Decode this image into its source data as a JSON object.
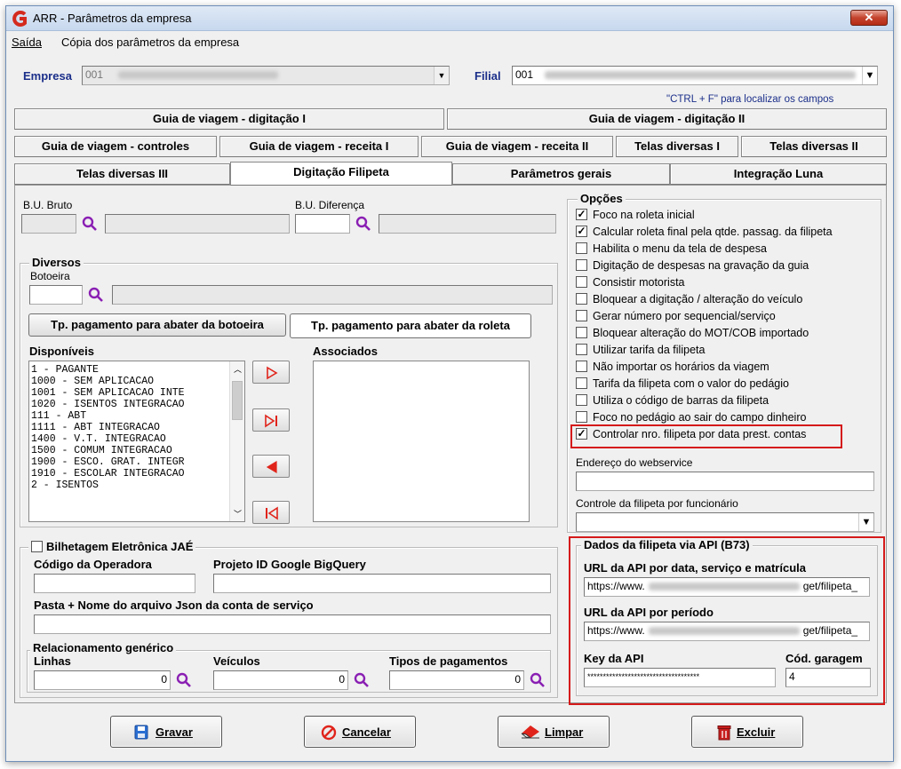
{
  "window": {
    "title": "ARR - Parâmetros da empresa",
    "close_glyph": "✕"
  },
  "menu": {
    "items": [
      "Saída",
      "Cópia dos parâmetros da empresa"
    ]
  },
  "empresa": {
    "label": "Empresa",
    "code": "001"
  },
  "filial": {
    "label": "Filial",
    "code": "001"
  },
  "hint": "\"CTRL + F\" para localizar os campos",
  "tabs": {
    "row1": [
      "Guia de viagem - digitação I",
      "Guia de viagem - digitação II"
    ],
    "row2": [
      "Guia de viagem - controles",
      "Guia de viagem - receita I",
      "Guia de viagem - receita II",
      "Telas diversas I",
      "Telas diversas II"
    ],
    "row3": [
      "Telas diversas III",
      "Digitação Filipeta",
      "Parâmetros gerais",
      "Integração Luna"
    ],
    "active": "Digitação Filipeta"
  },
  "bu": {
    "bruto_label": "B.U. Bruto",
    "diferenca_label": "B.U. Diferença"
  },
  "diversos": {
    "title": "Diversos",
    "botoeira_label": "Botoeira",
    "btn_botoeira": "Tp. pagamento para abater da botoeira",
    "btn_roleta": "Tp. pagamento para abater da roleta",
    "disponiveis_label": "Disponíveis",
    "associados_label": "Associados",
    "disponiveis": [
      "1 - PAGANTE",
      "1000 - SEM APLICACAO",
      "1001 - SEM APLICACAO INTE",
      "1020 - ISENTOS INTEGRACAO",
      "111 - ABT",
      "1111 - ABT INTEGRACAO",
      "1400 - V.T. INTEGRACAO",
      "1500 - COMUM INTEGRACAO",
      "1900 - ESCO. GRAT. INTEGR",
      "1910 - ESCOLAR INTEGRACAO",
      "2 - ISENTOS"
    ]
  },
  "bilhetagem": {
    "title": "Bilhetagem Eletrônica JAÉ",
    "codigo_label": "Código da Operadora",
    "projeto_label": "Projeto ID Google BigQuery",
    "pasta_label": "Pasta + Nome do arquivo Json  da conta de serviço"
  },
  "relacionamento": {
    "title": "Relacionamento genérico",
    "linhas_label": "Linhas",
    "linhas_value": "0",
    "veiculos_label": "Veículos",
    "veiculos_value": "0",
    "tipos_label": "Tipos de pagamentos",
    "tipos_value": "0"
  },
  "opcoes": {
    "title": "Opções",
    "items": [
      {
        "label": "Foco na roleta inicial",
        "checked": true
      },
      {
        "label": "Calcular roleta final pela qtde. passag. da filipeta",
        "checked": true
      },
      {
        "label": "Habilita o menu da tela de despesa",
        "checked": false
      },
      {
        "label": "Digitação de despesas na gravação da guia",
        "checked": false
      },
      {
        "label": "Consistir motorista",
        "checked": false
      },
      {
        "label": "Bloquear a digitação / alteração do veículo",
        "checked": false
      },
      {
        "label": "Gerar número por sequencial/serviço",
        "checked": false
      },
      {
        "label": "Bloquear alteração do MOT/COB importado",
        "checked": false
      },
      {
        "label": "Utilizar tarifa da filipeta",
        "checked": false
      },
      {
        "label": "Não importar os horários da viagem",
        "checked": false
      },
      {
        "label": "Tarifa da filipeta com o valor do pedágio",
        "checked": false
      },
      {
        "label": "Utiliza o código de barras da filipeta",
        "checked": false
      },
      {
        "label": "Foco no pedágio ao sair do campo dinheiro",
        "checked": false
      },
      {
        "label": "Controlar nro. filipeta por data prest. contas",
        "checked": true
      }
    ],
    "webservice_label": "Endereço do webservice",
    "controle_label": "Controle da filipeta por funcionário"
  },
  "api": {
    "title": "Dados da filipeta via API (B73)",
    "url_data_label": "URL da API por data, serviço e matrícula",
    "url_data_prefix": "https://www.",
    "url_data_suffix": "get/filipeta_",
    "url_periodo_label": "URL da API por período",
    "url_periodo_prefix": "https://www.",
    "url_periodo_suffix": "get/filipeta_",
    "key_label": "Key da API",
    "key_value": "************************************",
    "garagem_label": "Cód. garagem",
    "garagem_value": "4"
  },
  "buttons": {
    "gravar": "Gravar",
    "cancelar": "Cancelar",
    "limpar": "Limpar",
    "excluir": "Excluir"
  },
  "colors": {
    "highlight": "#d51a1a",
    "link_blue": "#1b2f8a",
    "magnifier": "#8a1fb3",
    "arrow_red": "#e0241b"
  }
}
